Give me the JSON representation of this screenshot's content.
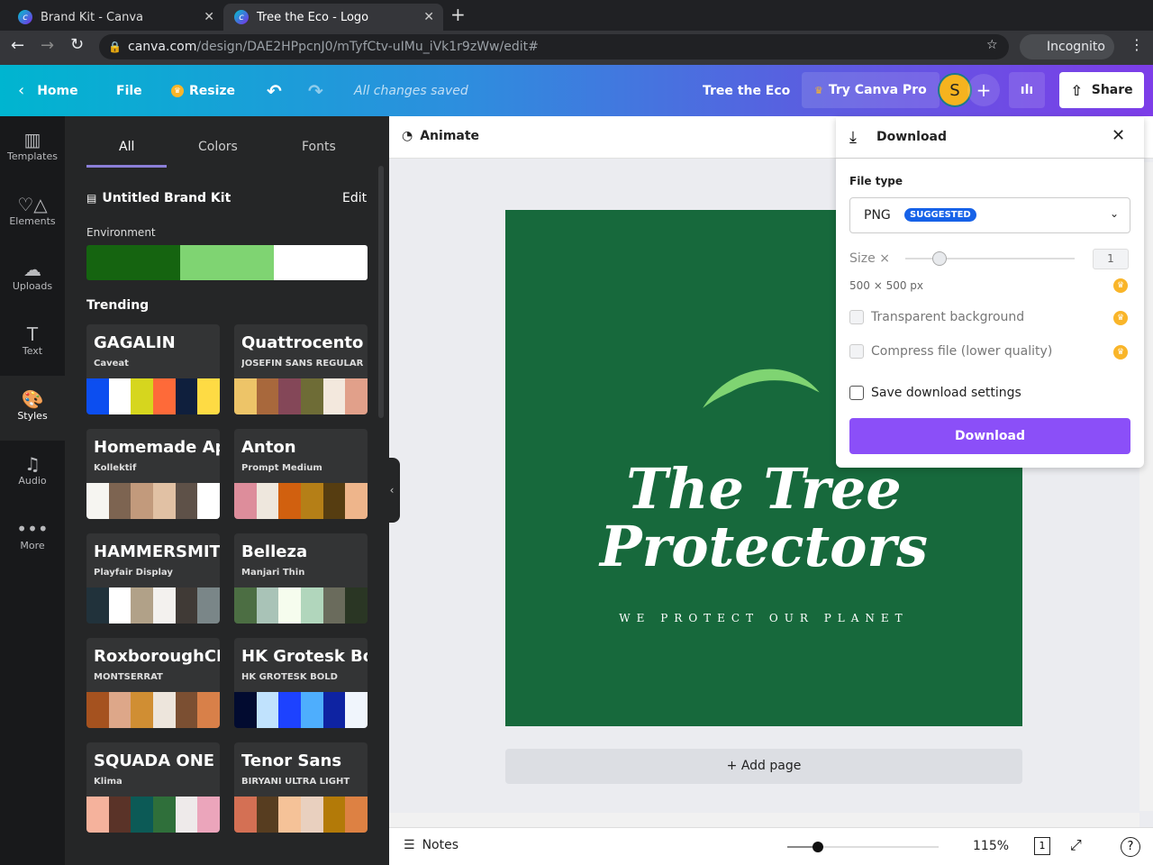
{
  "browser": {
    "tabs": [
      {
        "title": "Brand Kit - Canva"
      },
      {
        "title": "Tree the Eco - Logo"
      }
    ],
    "url_host": "canva.com",
    "url_path": "/design/DAE2HPpcnJ0/mTyfCtv-uIMu_iVk1r9zWw/edit#",
    "profile": "Incognito"
  },
  "header": {
    "home": "Home",
    "file": "File",
    "resize": "Resize",
    "status": "All changes saved",
    "design_name": "Tree the Eco",
    "try_pro": "Try Canva Pro",
    "avatar": "S",
    "share": "Share"
  },
  "rail": [
    {
      "label": "Templates",
      "icon": "▥"
    },
    {
      "label": "Elements",
      "icon": "♡△"
    },
    {
      "label": "Uploads",
      "icon": "☁"
    },
    {
      "label": "Text",
      "icon": "T"
    },
    {
      "label": "Styles",
      "icon": "🎨"
    },
    {
      "label": "Audio",
      "icon": "♫"
    },
    {
      "label": "More",
      "icon": "•••"
    }
  ],
  "panel": {
    "tabs": [
      "All",
      "Colors",
      "Fonts"
    ],
    "brand_kit": "Untitled Brand Kit",
    "edit": "Edit",
    "palette_name": "Environment",
    "palette": [
      "#156410",
      "#7fd472",
      "#ffffff"
    ],
    "trending": "Trending",
    "cards": [
      {
        "t1": "GAGALIN",
        "t2": "Caveat",
        "colors": [
          "#0c4ef0",
          "#ffffff",
          "#d6d61e",
          "#fe6a39",
          "#0f1f3d",
          "#fedb44"
        ]
      },
      {
        "t1": "Quattrocento",
        "t2": "JOSEFIN SANS REGULAR",
        "colors": [
          "#edc468",
          "#a8683c",
          "#844758",
          "#6e6c36",
          "#f3e8dd",
          "#e1a08a"
        ]
      },
      {
        "t1": "Homemade Apple",
        "t2": "Kollektif",
        "colors": [
          "#f6f5f1",
          "#7d6451",
          "#c29a7c",
          "#e1c1a4",
          "#5e5148",
          "#ffffff"
        ]
      },
      {
        "t1": "Anton",
        "t2": "Prompt Medium",
        "colors": [
          "#dd8d9b",
          "#eee7dd",
          "#d1600f",
          "#b57f17",
          "#563d11",
          "#eeb58b"
        ]
      },
      {
        "t1": "HAMMERSMITH",
        "t2": "Playfair Display",
        "colors": [
          "#21323b",
          "#ffffff",
          "#b1a188",
          "#f3f1ee",
          "#403a36",
          "#7a8688"
        ]
      },
      {
        "t1": "Belleza",
        "t2": "Manjari Thin",
        "colors": [
          "#4c6e43",
          "#a9c3b7",
          "#f6fdee",
          "#b1d6bc",
          "#6a6b5c",
          "#2a3624"
        ]
      },
      {
        "t1": "RoxboroughCF",
        "t2": "MONTSERRAT",
        "colors": [
          "#a5521f",
          "#dda789",
          "#d08e33",
          "#ede5dc",
          "#7b4f32",
          "#d88049"
        ]
      },
      {
        "t1": "HK Grotesk Bold",
        "t2": "HK GROTESK BOLD",
        "colors": [
          "#020b30",
          "#c0e2fd",
          "#1d42ff",
          "#4eaefd",
          "#0e23a2",
          "#f0f5fc"
        ]
      },
      {
        "t1": "SQUADA ONE",
        "t2": "Klima",
        "colors": [
          "#f5b29c",
          "#5a3328",
          "#0c5a56",
          "#2f6f3a",
          "#eeeaea",
          "#eba5bb"
        ]
      },
      {
        "t1": "Tenor Sans",
        "t2": "BIRYANI ULTRA LIGHT",
        "colors": [
          "#d47054",
          "#573d20",
          "#f5c298",
          "#e9d0bf",
          "#b37a08",
          "#dd8143"
        ]
      }
    ]
  },
  "editor": {
    "animate": "Animate",
    "design_title": "The Tree Protectors",
    "tagline": "WE PROTECT OUR PLANET",
    "add_page": "+ Add page",
    "notes": "Notes",
    "zoom": "115%",
    "page_count": "1",
    "zoom_level": 0.2
  },
  "download": {
    "title": "Download",
    "file_type_label": "File type",
    "file_type": "PNG",
    "badge": "SUGGESTED",
    "size_label": "Size ×",
    "size_value": "1",
    "size_fraction": 0.2,
    "dimensions": "500 × 500 px",
    "options": [
      "Transparent background",
      "Compress file (lower quality)"
    ],
    "save_settings": "Save download settings",
    "button": "Download",
    "accent": "#8b4ff8"
  }
}
